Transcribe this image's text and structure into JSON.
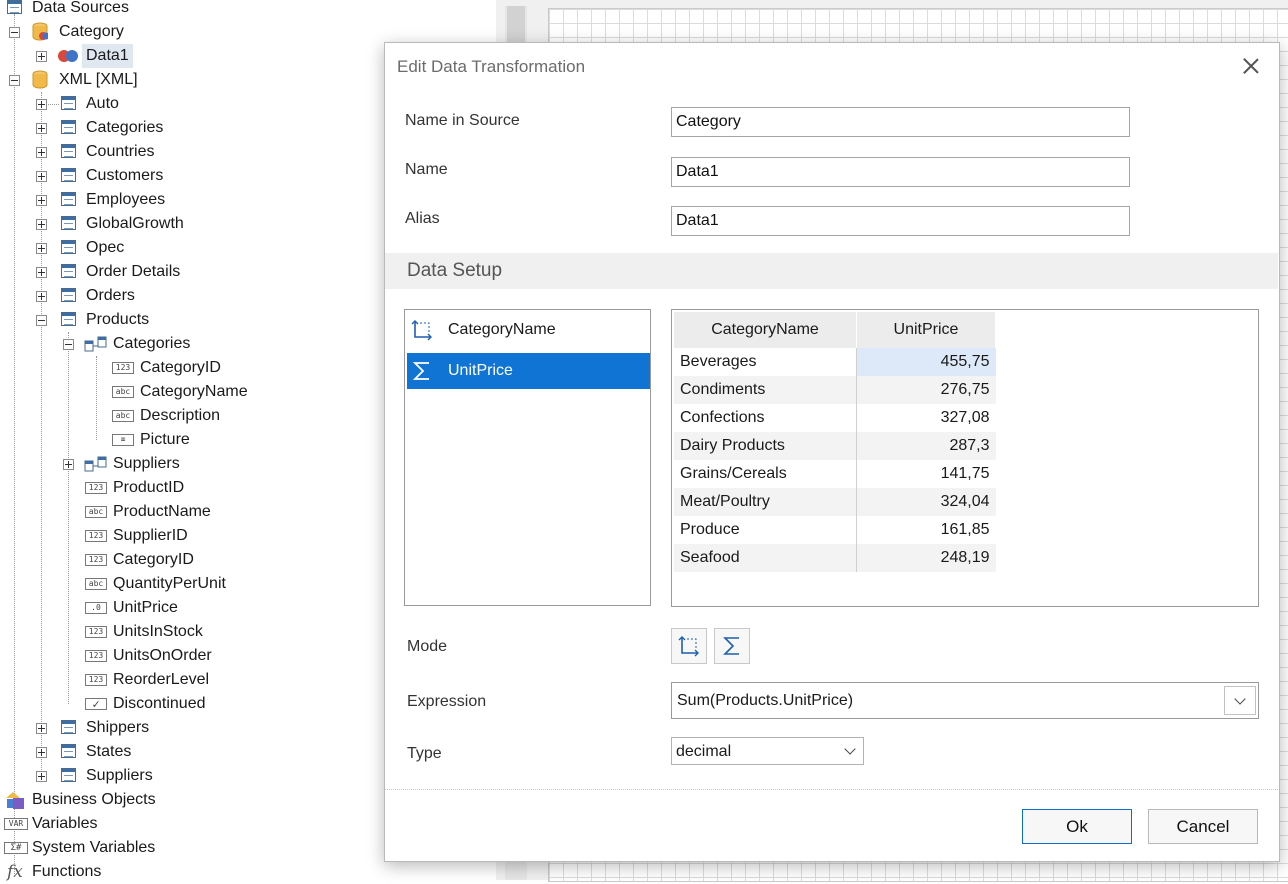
{
  "tree": {
    "root": "Data Sources",
    "category_source": "Category",
    "data1": "Data1",
    "xml_source": "XML [XML]",
    "tables_top": [
      "Auto",
      "Categories",
      "Countries",
      "Customers",
      "Employees",
      "GlobalGrowth",
      "Opec",
      "Order Details",
      "Orders",
      "Products"
    ],
    "products_children": {
      "categories": "Categories",
      "categories_fields": [
        {
          "type": "123",
          "label": "CategoryID"
        },
        {
          "type": "abc",
          "label": "CategoryName"
        },
        {
          "type": "abc",
          "label": "Description"
        },
        {
          "type": "img",
          "label": "Picture"
        }
      ],
      "suppliers": "Suppliers",
      "fields": [
        {
          "type": "123",
          "label": "ProductID"
        },
        {
          "type": "abc",
          "label": "ProductName"
        },
        {
          "type": "123",
          "label": "SupplierID"
        },
        {
          "type": "123",
          "label": "CategoryID"
        },
        {
          "type": "abc",
          "label": "QuantityPerUnit"
        },
        {
          "type": "dec",
          "label": "UnitPrice"
        },
        {
          "type": "123",
          "label": "UnitsInStock"
        },
        {
          "type": "123",
          "label": "UnitsOnOrder"
        },
        {
          "type": "123",
          "label": "ReorderLevel"
        },
        {
          "type": "chk",
          "label": "Discontinued"
        }
      ]
    },
    "tables_bottom": [
      "Shippers",
      "States",
      "Suppliers"
    ],
    "business_objects": "Business Objects",
    "variables": "Variables",
    "system_variables": "System Variables",
    "functions": "Functions"
  },
  "dialog": {
    "title": "Edit Data Transformation",
    "name_in_source_label": "Name in Source",
    "name_in_source_value": "Category",
    "name_label": "Name",
    "name_value": "Data1",
    "alias_label": "Alias",
    "alias_value": "Data1",
    "section_title": "Data Setup",
    "columns": [
      {
        "label": "CategoryName",
        "icon": "dimension-icon"
      },
      {
        "label": "UnitPrice",
        "icon": "sigma-icon",
        "selected": true
      }
    ],
    "grid": {
      "headers": [
        "CategoryName",
        "UnitPrice"
      ],
      "rows": [
        [
          "Beverages",
          "455,75"
        ],
        [
          "Condiments",
          "276,75"
        ],
        [
          "Confections",
          "327,08"
        ],
        [
          "Dairy Products",
          "287,3"
        ],
        [
          "Grains/Cereals",
          "141,75"
        ],
        [
          "Meat/Poultry",
          "324,04"
        ],
        [
          "Produce",
          "161,85"
        ],
        [
          "Seafood",
          "248,19"
        ]
      ]
    },
    "mode_label": "Mode",
    "expression_label": "Expression",
    "expression_value": "Sum(Products.UnitPrice)",
    "type_label": "Type",
    "type_value": "decimal",
    "ok_label": "Ok",
    "cancel_label": "Cancel"
  }
}
